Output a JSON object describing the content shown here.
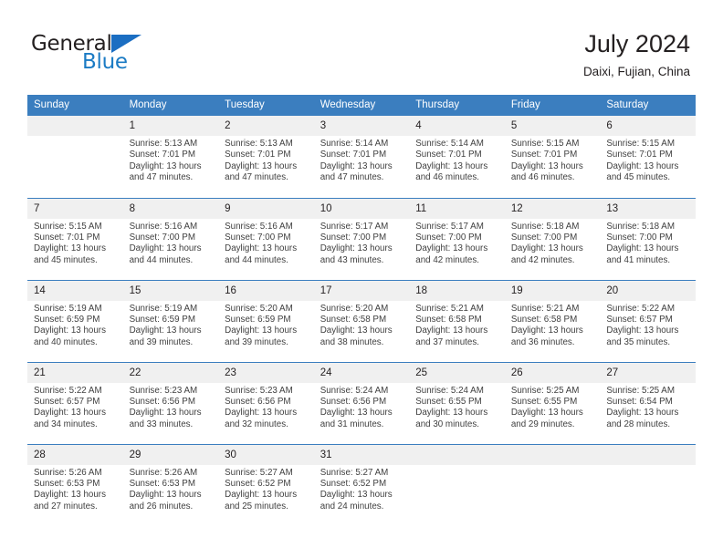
{
  "brand": {
    "name_top": "General",
    "name_bottom": "Blue",
    "triangle_icon": "triangle-icon",
    "color_dark": "#231f20",
    "color_blue": "#1b7bc4"
  },
  "header": {
    "title": "July 2024",
    "subtitle": "Daixi, Fujian, China"
  },
  "theme": {
    "header_blue": "#3b7ebf",
    "daynum_band": "#f0f0f0",
    "text": "#231f20"
  },
  "calendar": {
    "weekday_headers": [
      "Sunday",
      "Monday",
      "Tuesday",
      "Wednesday",
      "Thursday",
      "Friday",
      "Saturday"
    ],
    "weeks": [
      [
        {
          "day": "",
          "lines": []
        },
        {
          "day": "1",
          "lines": [
            "Sunrise: 5:13 AM",
            "Sunset: 7:01 PM",
            "Daylight: 13 hours",
            "and 47 minutes."
          ]
        },
        {
          "day": "2",
          "lines": [
            "Sunrise: 5:13 AM",
            "Sunset: 7:01 PM",
            "Daylight: 13 hours",
            "and 47 minutes."
          ]
        },
        {
          "day": "3",
          "lines": [
            "Sunrise: 5:14 AM",
            "Sunset: 7:01 PM",
            "Daylight: 13 hours",
            "and 47 minutes."
          ]
        },
        {
          "day": "4",
          "lines": [
            "Sunrise: 5:14 AM",
            "Sunset: 7:01 PM",
            "Daylight: 13 hours",
            "and 46 minutes."
          ]
        },
        {
          "day": "5",
          "lines": [
            "Sunrise: 5:15 AM",
            "Sunset: 7:01 PM",
            "Daylight: 13 hours",
            "and 46 minutes."
          ]
        },
        {
          "day": "6",
          "lines": [
            "Sunrise: 5:15 AM",
            "Sunset: 7:01 PM",
            "Daylight: 13 hours",
            "and 45 minutes."
          ]
        }
      ],
      [
        {
          "day": "7",
          "lines": [
            "Sunrise: 5:15 AM",
            "Sunset: 7:01 PM",
            "Daylight: 13 hours",
            "and 45 minutes."
          ]
        },
        {
          "day": "8",
          "lines": [
            "Sunrise: 5:16 AM",
            "Sunset: 7:00 PM",
            "Daylight: 13 hours",
            "and 44 minutes."
          ]
        },
        {
          "day": "9",
          "lines": [
            "Sunrise: 5:16 AM",
            "Sunset: 7:00 PM",
            "Daylight: 13 hours",
            "and 44 minutes."
          ]
        },
        {
          "day": "10",
          "lines": [
            "Sunrise: 5:17 AM",
            "Sunset: 7:00 PM",
            "Daylight: 13 hours",
            "and 43 minutes."
          ]
        },
        {
          "day": "11",
          "lines": [
            "Sunrise: 5:17 AM",
            "Sunset: 7:00 PM",
            "Daylight: 13 hours",
            "and 42 minutes."
          ]
        },
        {
          "day": "12",
          "lines": [
            "Sunrise: 5:18 AM",
            "Sunset: 7:00 PM",
            "Daylight: 13 hours",
            "and 42 minutes."
          ]
        },
        {
          "day": "13",
          "lines": [
            "Sunrise: 5:18 AM",
            "Sunset: 7:00 PM",
            "Daylight: 13 hours",
            "and 41 minutes."
          ]
        }
      ],
      [
        {
          "day": "14",
          "lines": [
            "Sunrise: 5:19 AM",
            "Sunset: 6:59 PM",
            "Daylight: 13 hours",
            "and 40 minutes."
          ]
        },
        {
          "day": "15",
          "lines": [
            "Sunrise: 5:19 AM",
            "Sunset: 6:59 PM",
            "Daylight: 13 hours",
            "and 39 minutes."
          ]
        },
        {
          "day": "16",
          "lines": [
            "Sunrise: 5:20 AM",
            "Sunset: 6:59 PM",
            "Daylight: 13 hours",
            "and 39 minutes."
          ]
        },
        {
          "day": "17",
          "lines": [
            "Sunrise: 5:20 AM",
            "Sunset: 6:58 PM",
            "Daylight: 13 hours",
            "and 38 minutes."
          ]
        },
        {
          "day": "18",
          "lines": [
            "Sunrise: 5:21 AM",
            "Sunset: 6:58 PM",
            "Daylight: 13 hours",
            "and 37 minutes."
          ]
        },
        {
          "day": "19",
          "lines": [
            "Sunrise: 5:21 AM",
            "Sunset: 6:58 PM",
            "Daylight: 13 hours",
            "and 36 minutes."
          ]
        },
        {
          "day": "20",
          "lines": [
            "Sunrise: 5:22 AM",
            "Sunset: 6:57 PM",
            "Daylight: 13 hours",
            "and 35 minutes."
          ]
        }
      ],
      [
        {
          "day": "21",
          "lines": [
            "Sunrise: 5:22 AM",
            "Sunset: 6:57 PM",
            "Daylight: 13 hours",
            "and 34 minutes."
          ]
        },
        {
          "day": "22",
          "lines": [
            "Sunrise: 5:23 AM",
            "Sunset: 6:56 PM",
            "Daylight: 13 hours",
            "and 33 minutes."
          ]
        },
        {
          "day": "23",
          "lines": [
            "Sunrise: 5:23 AM",
            "Sunset: 6:56 PM",
            "Daylight: 13 hours",
            "and 32 minutes."
          ]
        },
        {
          "day": "24",
          "lines": [
            "Sunrise: 5:24 AM",
            "Sunset: 6:56 PM",
            "Daylight: 13 hours",
            "and 31 minutes."
          ]
        },
        {
          "day": "25",
          "lines": [
            "Sunrise: 5:24 AM",
            "Sunset: 6:55 PM",
            "Daylight: 13 hours",
            "and 30 minutes."
          ]
        },
        {
          "day": "26",
          "lines": [
            "Sunrise: 5:25 AM",
            "Sunset: 6:55 PM",
            "Daylight: 13 hours",
            "and 29 minutes."
          ]
        },
        {
          "day": "27",
          "lines": [
            "Sunrise: 5:25 AM",
            "Sunset: 6:54 PM",
            "Daylight: 13 hours",
            "and 28 minutes."
          ]
        }
      ],
      [
        {
          "day": "28",
          "lines": [
            "Sunrise: 5:26 AM",
            "Sunset: 6:53 PM",
            "Daylight: 13 hours",
            "and 27 minutes."
          ]
        },
        {
          "day": "29",
          "lines": [
            "Sunrise: 5:26 AM",
            "Sunset: 6:53 PM",
            "Daylight: 13 hours",
            "and 26 minutes."
          ]
        },
        {
          "day": "30",
          "lines": [
            "Sunrise: 5:27 AM",
            "Sunset: 6:52 PM",
            "Daylight: 13 hours",
            "and 25 minutes."
          ]
        },
        {
          "day": "31",
          "lines": [
            "Sunrise: 5:27 AM",
            "Sunset: 6:52 PM",
            "Daylight: 13 hours",
            "and 24 minutes."
          ]
        },
        {
          "day": "",
          "lines": []
        },
        {
          "day": "",
          "lines": []
        },
        {
          "day": "",
          "lines": []
        }
      ]
    ]
  }
}
